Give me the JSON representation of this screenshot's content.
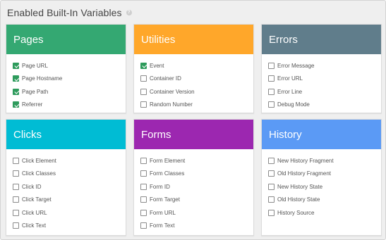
{
  "title": "Enabled Built-In Variables",
  "help_glyph": "?",
  "cards": [
    {
      "title": "Pages",
      "color": "#34a872",
      "items": [
        {
          "label": "Page URL",
          "checked": true
        },
        {
          "label": "Page Hostname",
          "checked": true
        },
        {
          "label": "Page Path",
          "checked": true
        },
        {
          "label": "Referrer",
          "checked": true
        }
      ]
    },
    {
      "title": "Utilities",
      "color": "#ffa72a",
      "items": [
        {
          "label": "Event",
          "checked": true
        },
        {
          "label": "Container ID",
          "checked": false
        },
        {
          "label": "Container Version",
          "checked": false
        },
        {
          "label": "Random Number",
          "checked": false
        }
      ]
    },
    {
      "title": "Errors",
      "color": "#607d8b",
      "items": [
        {
          "label": "Error Message",
          "checked": false
        },
        {
          "label": "Error URL",
          "checked": false
        },
        {
          "label": "Error Line",
          "checked": false
        },
        {
          "label": "Debug Mode",
          "checked": false
        }
      ]
    },
    {
      "title": "Clicks",
      "color": "#00bcd4",
      "items": [
        {
          "label": "Click Element",
          "checked": false
        },
        {
          "label": "Click Classes",
          "checked": false
        },
        {
          "label": "Click ID",
          "checked": false
        },
        {
          "label": "Click Target",
          "checked": false
        },
        {
          "label": "Click URL",
          "checked": false
        },
        {
          "label": "Click Text",
          "checked": false
        }
      ]
    },
    {
      "title": "Forms",
      "color": "#9c27b0",
      "items": [
        {
          "label": "Form Element",
          "checked": false
        },
        {
          "label": "Form Classes",
          "checked": false
        },
        {
          "label": "Form ID",
          "checked": false
        },
        {
          "label": "Form Target",
          "checked": false
        },
        {
          "label": "Form URL",
          "checked": false
        },
        {
          "label": "Form Text",
          "checked": false
        }
      ]
    },
    {
      "title": "History",
      "color": "#5b9af5",
      "items": [
        {
          "label": "New History Fragment",
          "checked": false
        },
        {
          "label": "Old History Fragment",
          "checked": false
        },
        {
          "label": "New History State",
          "checked": false
        },
        {
          "label": "Old History State",
          "checked": false
        },
        {
          "label": "History Source",
          "checked": false
        }
      ]
    }
  ]
}
